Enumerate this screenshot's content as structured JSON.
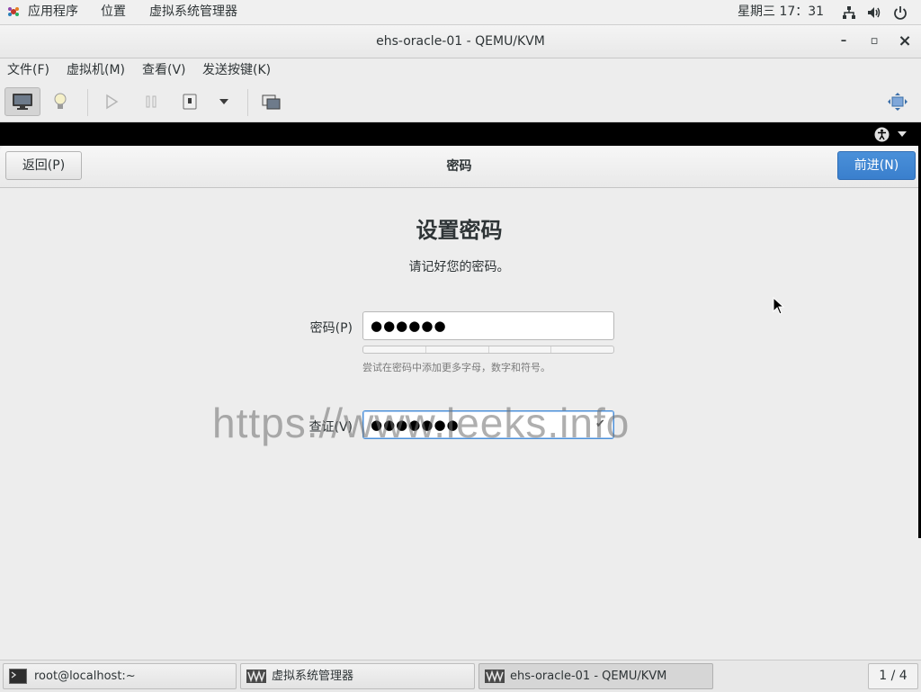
{
  "top_panel": {
    "applications": "应用程序",
    "places": "位置",
    "virt_manager": "虚拟系统管理器",
    "clock": "星期三 17：31",
    "icons": [
      "network-icon",
      "volume-icon",
      "power-icon"
    ]
  },
  "window": {
    "title": "ehs-oracle-01 - QEMU/KVM",
    "minimize": "–",
    "maximize": "▫",
    "close": "×"
  },
  "menubar": {
    "items": [
      "文件(F)",
      "虚拟机(M)",
      "查看(V)",
      "发送按键(K)"
    ]
  },
  "toolbar": {
    "icons": [
      "monitor-icon",
      "lightbulb-icon",
      "play-icon",
      "pause-icon",
      "shutdown-icon",
      "dropdown-arrow-icon",
      "snapshot-icon",
      "fullscreen-icon"
    ]
  },
  "installer": {
    "back_label": "返回(P)",
    "header_title": "密码",
    "next_label": "前进(N)",
    "heading": "设置密码",
    "subheading": "请记好您的密码。",
    "password_label": "密码(P)",
    "password_value": "●●●●●●",
    "strength_hint": "尝试在密码中添加更多字母，数字和符号。",
    "verify_label": "查证(V)",
    "verify_value": "●●●●●●●",
    "check_mark": "✔"
  },
  "watermark": "https://www.leeks.info",
  "taskbar": {
    "tasks": [
      "root@localhost:~",
      "虚拟系统管理器",
      "ehs-oracle-01 - QEMU/KVM"
    ],
    "workspace": "1 / 4"
  },
  "colors": {
    "accent": "#3a7fcd",
    "background": "#ededed"
  }
}
